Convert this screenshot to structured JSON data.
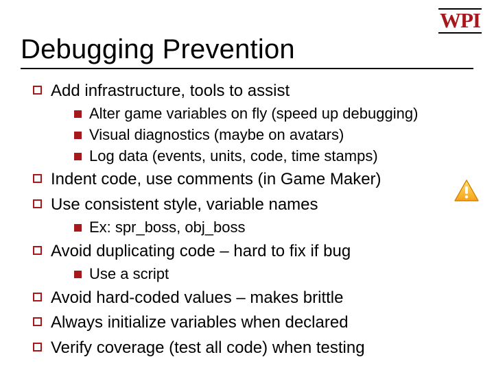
{
  "logo": "WPI",
  "title": "Debugging Prevention",
  "bullets": [
    {
      "text": "Add infrastructure, tools to assist",
      "sub": [
        "Alter game variables on fly (speed up debugging)",
        "Visual diagnostics  (maybe on avatars)",
        "Log data (events, units, code, time stamps)"
      ]
    },
    {
      "text": "Indent code, use comments (in Game Maker)",
      "sub": []
    },
    {
      "text": "Use consistent style, variable names",
      "sub": [
        "Ex: spr_boss, obj_boss"
      ]
    },
    {
      "text": "Avoid duplicating code – hard to fix if bug",
      "sub": [
        "Use a script"
      ]
    },
    {
      "text": "Avoid hard-coded values – makes brittle",
      "sub": []
    },
    {
      "text": "Always initialize variables when declared",
      "sub": []
    },
    {
      "text": "Verify coverage (test all code) when testing",
      "sub": []
    }
  ],
  "warning_icon": "!"
}
